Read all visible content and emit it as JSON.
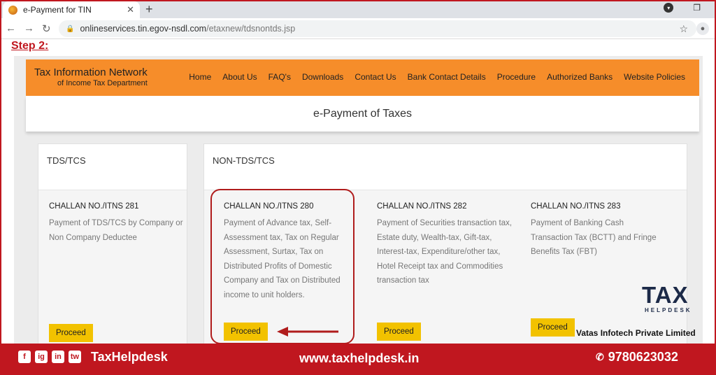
{
  "browser": {
    "tab_title": "e-Payment for TIN",
    "tab_close": "✕",
    "new_tab": "+",
    "url_host": "onlineservices.tin.egov-nsdl.com",
    "url_path": "/etaxnew/tdsnontds.jsp"
  },
  "step_label": "Step 2:",
  "site": {
    "brand_line1": "Tax Information Network",
    "brand_line2": "of Income Tax Department",
    "nav": [
      "Home",
      "About Us",
      "FAQ's",
      "Downloads",
      "Contact Us",
      "Bank Contact Details",
      "Procedure",
      "Authorized Banks",
      "Website Policies"
    ],
    "page_title": "e-Payment of Taxes"
  },
  "panels": {
    "tds": {
      "heading": "TDS/TCS",
      "challans": [
        {
          "title": "CHALLAN NO./ITNS 281",
          "desc": "Payment of TDS/TCS by Company or Non Company Deductee",
          "button": "Proceed"
        }
      ]
    },
    "non_tds": {
      "heading": "NON-TDS/TCS",
      "challans": [
        {
          "title": "CHALLAN NO./ITNS 280",
          "desc": "Payment of Advance tax, Self-Assessment tax, Tax on Regular Assessment, Surtax, Tax on Distributed Profits of Domestic Company and Tax on Distributed income to unit holders.",
          "button": "Proceed"
        },
        {
          "title": "CHALLAN NO./ITNS 282",
          "desc": "Payment of Securities transaction tax, Estate duty, Wealth-tax, Gift-tax, Interest-tax, Expenditure/other tax, Hotel Receipt tax and Commodities transaction tax",
          "button": "Proceed"
        },
        {
          "title": "CHALLAN NO./ITNS 283",
          "desc": "Payment of Banking Cash Transaction Tax (BCTT) and Fringe Benefits Tax (FBT)",
          "button": "Proceed"
        }
      ]
    }
  },
  "watermark": {
    "logo_main": "TAX",
    "logo_sub": "HELPDESK",
    "company": "Vatas Infotech Private Limited"
  },
  "footer": {
    "socials": [
      "f",
      "ig",
      "in",
      "tw"
    ],
    "handle": "TaxHelpdesk",
    "website": "www.taxhelpdesk.in",
    "phone": "9780623032"
  },
  "colors": {
    "brand_red": "#c0171f",
    "header_orange": "#f68d2a",
    "button_yellow": "#f2c200"
  }
}
